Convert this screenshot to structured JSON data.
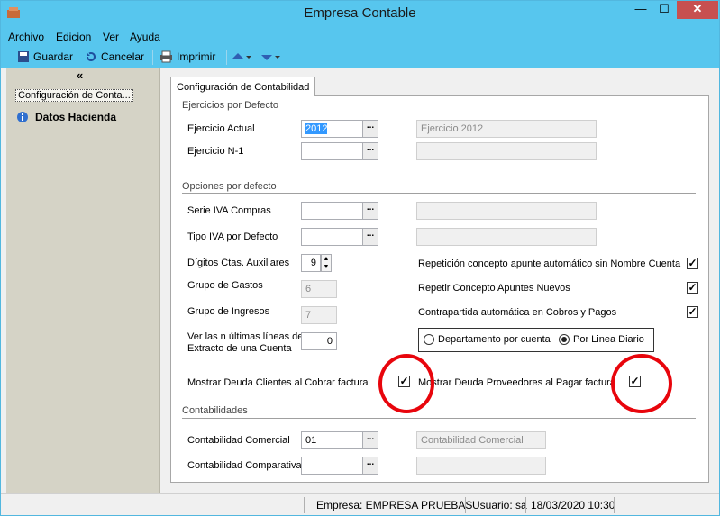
{
  "window": {
    "title": "Empresa Contable"
  },
  "menu": [
    "Archivo",
    "Edicion",
    "Ver",
    "Ayuda"
  ],
  "toolbar": {
    "save": "Guardar",
    "cancel": "Cancelar",
    "print": "Imprimir"
  },
  "sidebar": {
    "collapse": "«",
    "items": [
      "Configuración de Conta...",
      "Datos Hacienda"
    ]
  },
  "tab": "Configuración de Contabilidad",
  "sections": {
    "ejercicios": "Ejercicios por Defecto",
    "opciones": "Opciones por defecto",
    "contabilidades": "Contabilidades"
  },
  "fields": {
    "ejercicio_actual": {
      "label": "Ejercicio Actual",
      "value": "2012",
      "desc": "Ejercicio 2012"
    },
    "ejercicio_n1": {
      "label": "Ejercicio N-1",
      "value": "",
      "desc": ""
    },
    "serie_iva": {
      "label": "Serie IVA Compras",
      "value": "",
      "desc": ""
    },
    "tipo_iva": {
      "label": "Tipo IVA por Defecto",
      "value": "",
      "desc": ""
    },
    "digitos": {
      "label": "Dígitos Ctas. Auxiliares",
      "value": "9"
    },
    "grupo_gastos": {
      "label": "Grupo de Gastos",
      "value": "6"
    },
    "grupo_ingresos": {
      "label": "Grupo de Ingresos",
      "value": "7"
    },
    "ultimas_lineas": {
      "label1": "Ver las n últimas líneas de",
      "label2": "Extracto de una Cuenta",
      "value": "0"
    },
    "deuda_clientes": {
      "label": "Mostrar Deuda Clientes al Cobrar factura",
      "checked": true
    },
    "deuda_proveedores": {
      "label": "Mostrar Deuda Proveedores al Pagar factura",
      "checked": true
    },
    "cont_comercial": {
      "label": "Contabilidad Comercial",
      "value": "01",
      "desc": "Contabilidad Comercial"
    },
    "cont_comparativa": {
      "label": "Contabilidad Comparativa",
      "value": "",
      "desc": ""
    }
  },
  "checks": {
    "repeticion": {
      "label": "Repetición concepto apunte automático sin Nombre Cuenta",
      "checked": true
    },
    "repetir": {
      "label": "Repetir Concepto Apuntes Nuevos",
      "checked": true
    },
    "contrapartida": {
      "label": "Contrapartida automática en Cobros y Pagos",
      "checked": true
    }
  },
  "radios": {
    "opt1": "Departamento por cuenta",
    "opt2": "Por Linea Diario",
    "selected": "opt2"
  },
  "status": {
    "empresa": "Empresa: EMPRESA PRUEBAS",
    "usuario": "Usuario: sa",
    "fecha": "18/03/2020 10:30"
  }
}
